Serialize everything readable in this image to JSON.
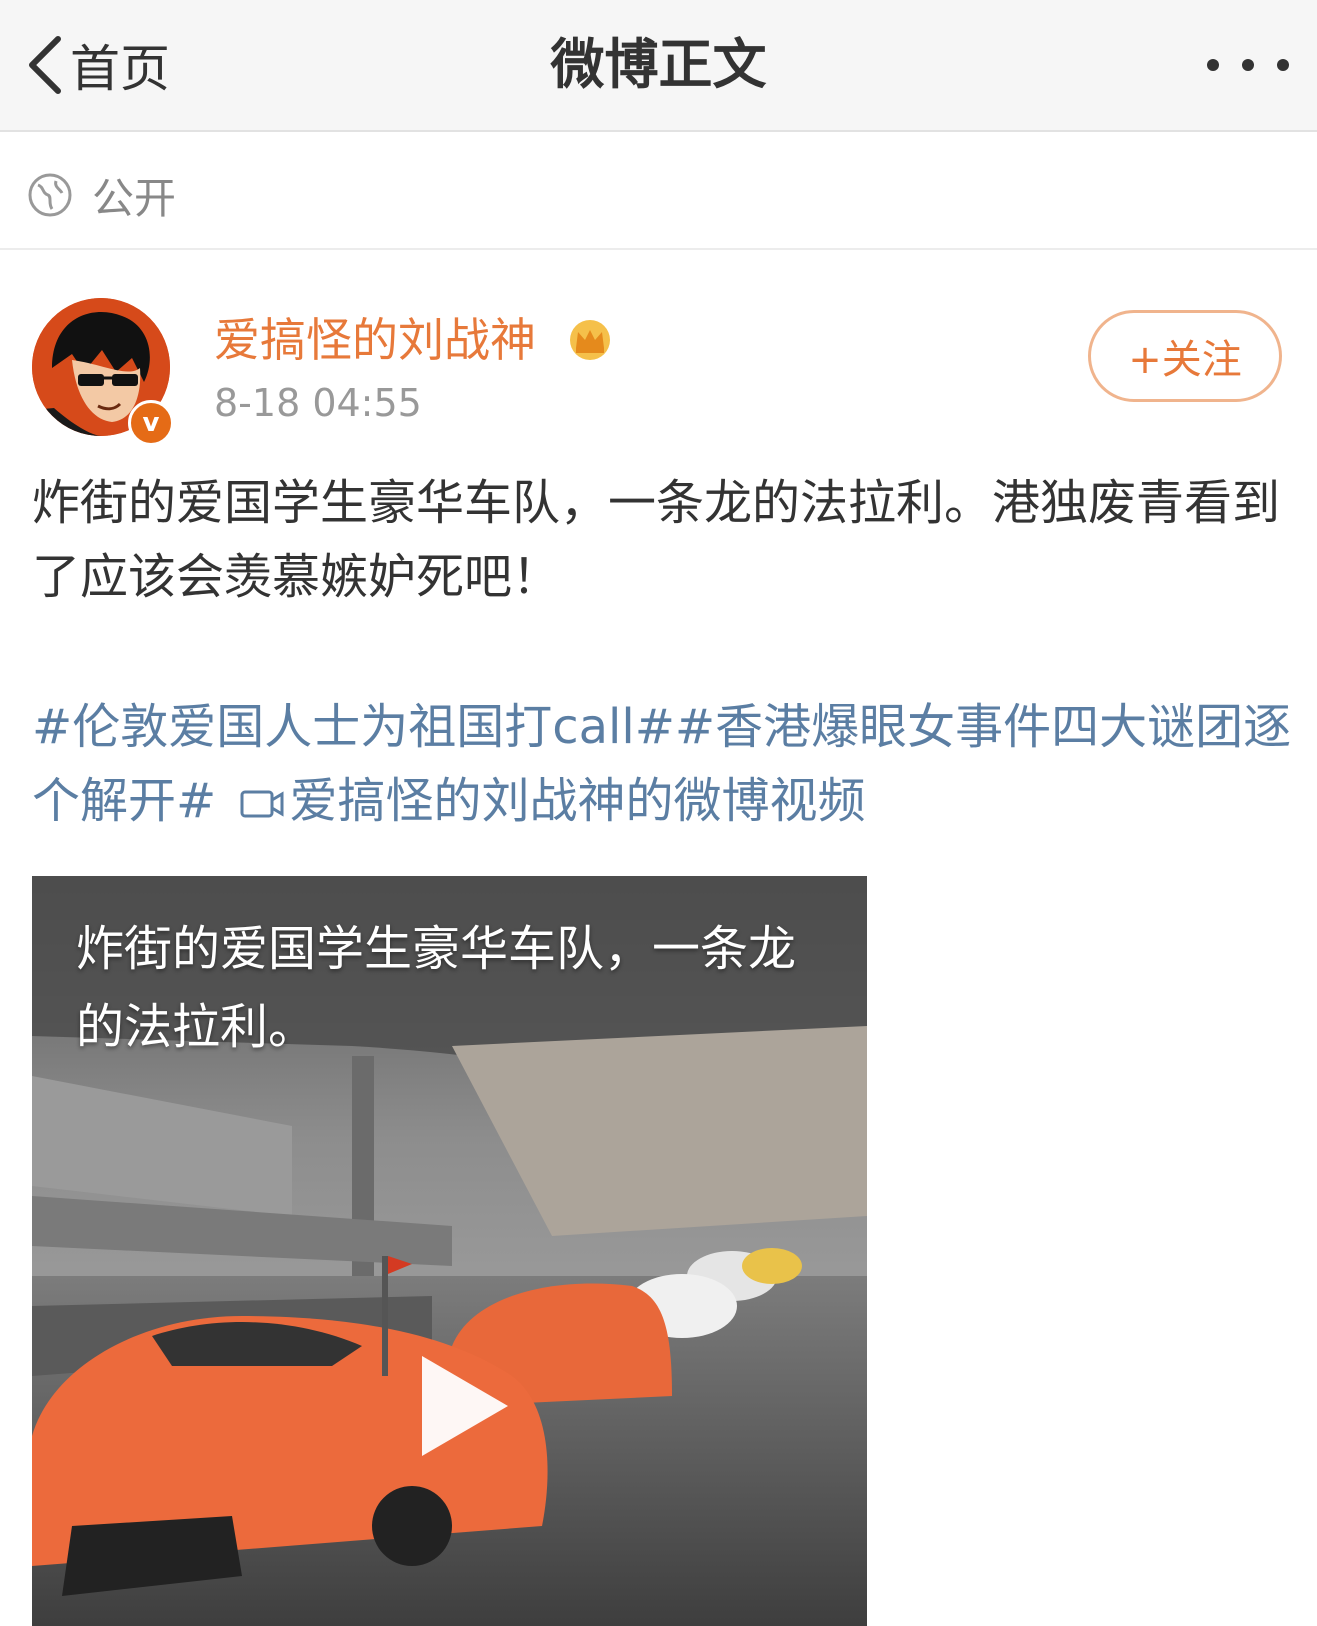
{
  "header": {
    "back_label": "首页",
    "title": "微博正文"
  },
  "visibility": {
    "label": "公开"
  },
  "post": {
    "username": "爱搞怪的刘战神",
    "timestamp": "8-18 04:55",
    "follow_label": "+关注",
    "text": "炸街的爱国学生豪华车队，一条龙的法拉利。港独废青看到了应该会羡慕嫉妒死吧！",
    "hashtags": [
      "#伦敦爱国人士为祖国打call#",
      "#香港爆眼女事件四大谜团逐个解开#"
    ],
    "video_link_label": "爱搞怪的刘战神的微博视频",
    "video_caption": "炸街的爱国学生豪华车队，一条龙的法拉利。"
  },
  "colors": {
    "accent": "#e7793a",
    "link": "#5b7ea3",
    "header_bg": "#f6f6f6"
  },
  "icons": [
    "chevron-left-icon",
    "more-dots-icon",
    "globe-icon",
    "crown-icon",
    "verified-badge-icon",
    "video-icon",
    "play-icon"
  ]
}
